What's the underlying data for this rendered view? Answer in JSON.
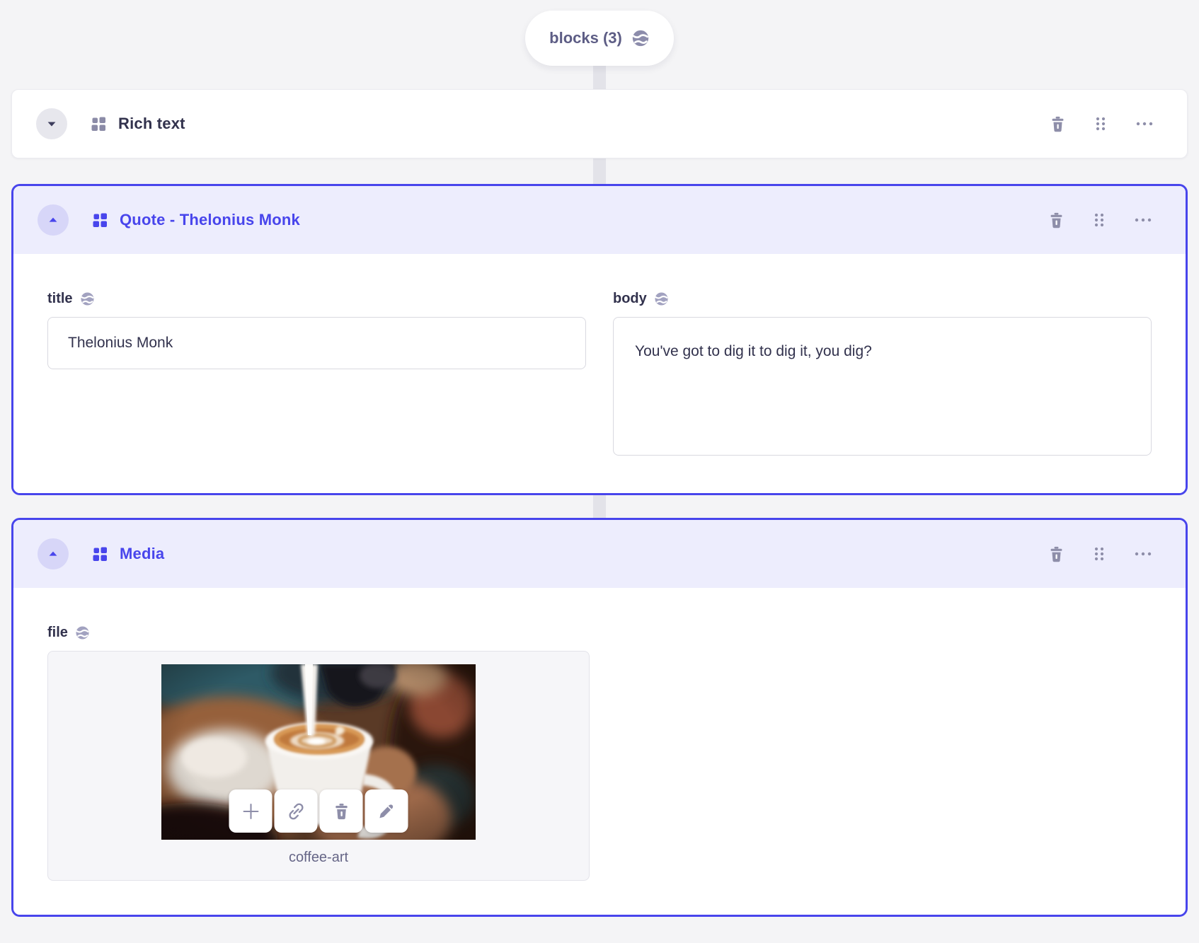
{
  "toolbar": {
    "blocks_pill": "blocks (3)"
  },
  "blocks": [
    {
      "title": "Rich text",
      "state": "collapsed",
      "actions": [
        "trash-icon",
        "drag-handle-icon",
        "more-options-icon"
      ]
    },
    {
      "title": "Quote - Thelonius Monk",
      "state": "expanded",
      "actions": [
        "trash-icon",
        "drag-handle-icon",
        "more-options-icon"
      ],
      "fields": {
        "title": {
          "label": "title",
          "value": "Thelonius Monk",
          "localized": true
        },
        "body": {
          "label": "body",
          "value": "You've got to dig it to dig it, you dig?",
          "localized": true
        }
      }
    },
    {
      "title": "Media",
      "state": "expanded",
      "actions": [
        "trash-icon",
        "drag-handle-icon",
        "more-options-icon"
      ],
      "fields": {
        "file": {
          "label": "file",
          "localized": true,
          "filename": "coffee-art",
          "thumbnail_actions": [
            "add-icon",
            "link-icon",
            "trash-icon",
            "edit-icon"
          ]
        }
      }
    }
  ],
  "colors": {
    "accent": "#4845ec",
    "active_header_bg": "#ededfd",
    "active_circle_bg": "#d7d6f8",
    "page_bg": "#f4f4f6",
    "icon_gray": "#8e8ea9",
    "text_dark": "#32324d",
    "pill_text": "#5d5d85",
    "caption_text": "#666687"
  }
}
